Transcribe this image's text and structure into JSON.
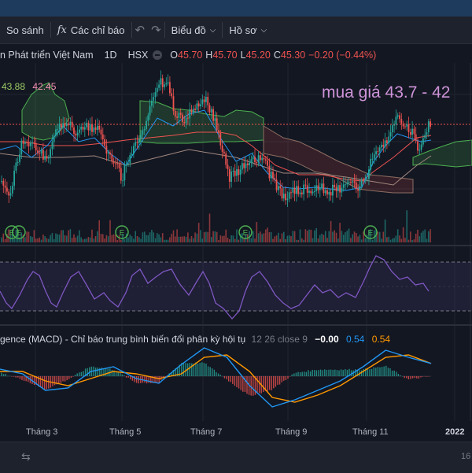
{
  "toolbar": {
    "compare_label": "So sánh",
    "indicators_icon": "fx",
    "indicators_label": "Các chỉ báo",
    "chart_type_label": "Biểu đồ",
    "profile_label": "Hồ sơ"
  },
  "legend": {
    "symbol_name": "n Phát triển Việt Nam",
    "interval": "1D",
    "exchange": "HSX",
    "o_label": "O",
    "o_value": "45.70",
    "h_label": "H",
    "h_value": "45.70",
    "l_label": "L",
    "l_value": "45.20",
    "c_label": "C",
    "c_value": "45.30",
    "change": "−0.20 (−0.44%)"
  },
  "ichimoku": {
    "value_a": "43.88",
    "value_b": "42.45"
  },
  "annotation": "mua giá 43.7 - 42",
  "macd": {
    "title": "gence (MACD) - Chỉ báo trung bình biến đổi phân kỳ hội tụ",
    "params": "12 26 close 9",
    "hist": "−0.00",
    "macd": "0.54",
    "signal": "0.54"
  },
  "time_axis": [
    "Tháng 3",
    "Tháng 5",
    "Tháng 7",
    "Tháng 9",
    "Tháng 11",
    "2022"
  ],
  "bottom": {
    "time_text": "16"
  },
  "colors": {
    "background": "#131722",
    "candle_up": "#26a69a",
    "candle_down": "#ef5350",
    "rsi_line": "#7e57c2",
    "macd_line": "#2196f3",
    "signal_line": "#ff9800",
    "annotation": "#ce93d8"
  },
  "chart_data": {
    "type": "line",
    "series": [
      {
        "name": "MACD",
        "values": [
          0.3,
          0.1,
          -0.6,
          -0.5,
          0.2,
          0.4,
          -0.1,
          -0.3,
          0.5,
          1.2,
          0.8,
          -0.4,
          -1.3,
          -1.0,
          -0.6,
          -0.2,
          0.4,
          1.1,
          0.8,
          0.54
        ]
      },
      {
        "name": "Signal",
        "values": [
          0.2,
          0.2,
          -0.2,
          -0.4,
          -0.1,
          0.2,
          0.1,
          -0.1,
          0.1,
          0.8,
          0.9,
          0.2,
          -0.9,
          -1.1,
          -0.8,
          -0.4,
          0.2,
          0.8,
          0.9,
          0.54
        ]
      }
    ]
  }
}
